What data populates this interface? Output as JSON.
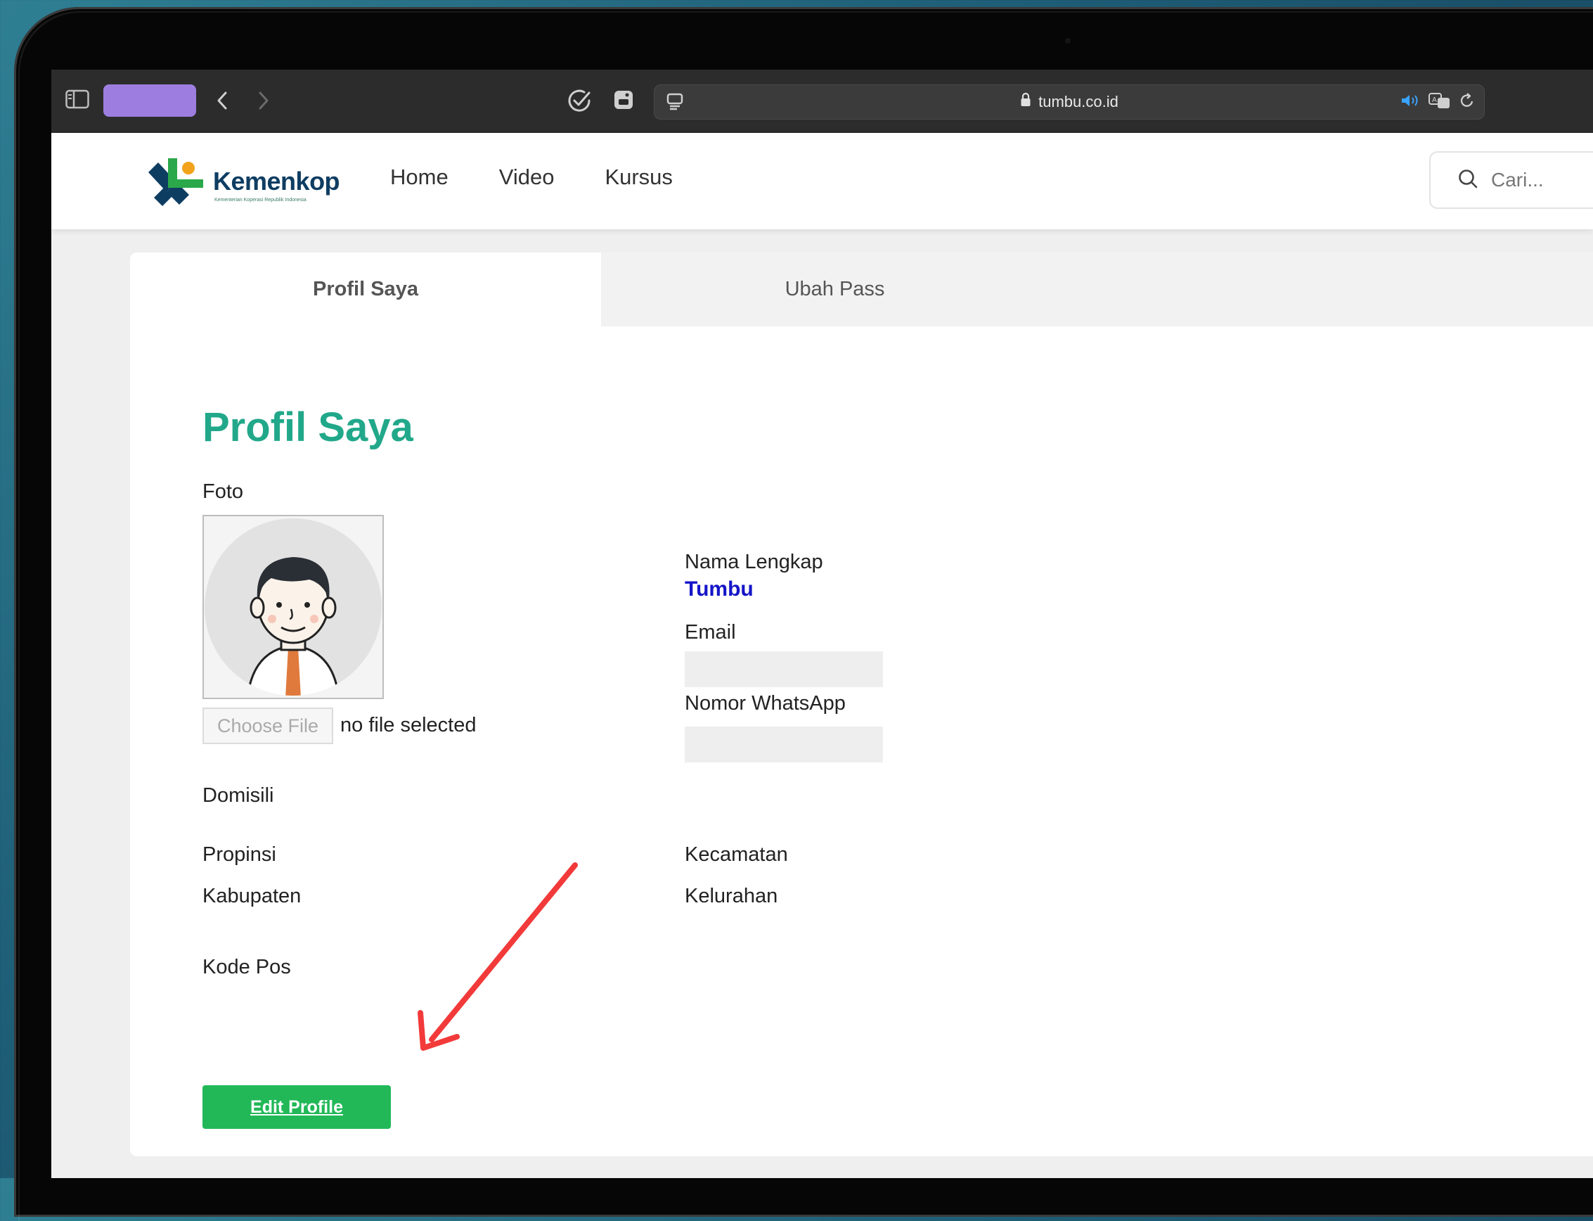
{
  "browser": {
    "url": "tumbu.co.id",
    "tab_color": "#9d7ee0"
  },
  "site": {
    "logo_title": "Kemenkop",
    "logo_subtitle": "Kementerian Koperasi Republik Indonesia",
    "nav": [
      "Home",
      "Video",
      "Kursus"
    ],
    "search_placeholder": "Cari..."
  },
  "tabs": [
    "Profil Saya",
    "Ubah Pass"
  ],
  "profile": {
    "title": "Profil Saya",
    "foto_label": "Foto",
    "choose_file_label": "Choose File",
    "file_status": "no file selected",
    "nama_label": "Nama Lengkap",
    "nama_value": "Tumbu",
    "email_label": "Email",
    "whatsapp_label": "Nomor WhatsApp",
    "domisili_label": "Domisili",
    "propinsi_label": "Propinsi",
    "kabupaten_label": "Kabupaten",
    "kecamatan_label": "Kecamatan",
    "kelurahan_label": "Kelurahan",
    "kodepos_label": "Kode Pos",
    "edit_button": "Edit Profile"
  },
  "colors": {
    "accent_title": "#21a88a",
    "name_blue": "#1515c8",
    "button_green": "#22b858",
    "arrow_red": "#f23a3a"
  }
}
